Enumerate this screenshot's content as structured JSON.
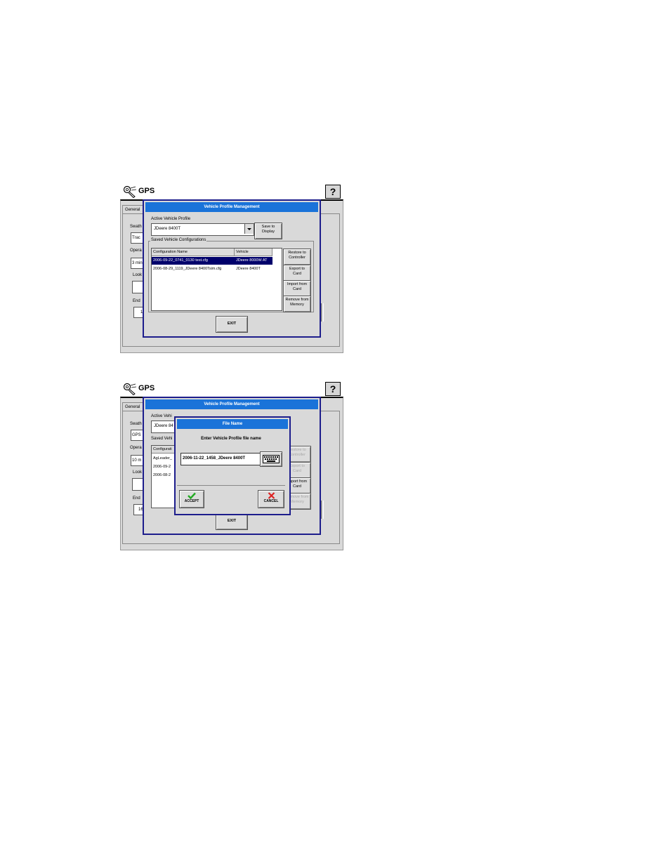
{
  "screen1": {
    "app_title": "GPS",
    "help_label": "?",
    "tab_general": "General",
    "side": {
      "swath": "Swath",
      "trac": "Trac",
      "opera": "Opera",
      "three_min": "3 min",
      "look": "Look",
      "end": "End",
      "one": "1"
    },
    "dialog": {
      "title": "Vehicle Profile Management",
      "active_label": "Active Vehicle Profile",
      "active_value": "JDeere 8400T",
      "save_button": "Save to\nDisplay",
      "saved_group_label": "Saved Vehicle Configurations",
      "columns": [
        "Configuration Name",
        "Vehicle"
      ],
      "rows": [
        {
          "name": "2006-09-22_0741_0130 test.cfg",
          "vehicle": "JDeere 8000W AT"
        },
        {
          "name": "2006-08-29_1119_JDeere 8400Tsim.cfg",
          "vehicle": "JDeere 8400T"
        }
      ],
      "buttons": {
        "restore": "Restore to\nController",
        "export": "Export to\nCard",
        "import": "Import from\nCard",
        "remove": "Remove from\nMemory"
      },
      "exit": "EXIT"
    }
  },
  "screen2": {
    "app_title": "GPS",
    "help_label": "?",
    "tab_general": "General",
    "side": {
      "swath": "Swath",
      "gps": "GPS",
      "opera": "Opera",
      "ten_m": "10 m",
      "look": "Look",
      "end": "End",
      "sixteen": "16"
    },
    "dialog": {
      "title": "Vehicle Profile Management",
      "active_label": "Active Vehi",
      "active_value": "JDeere 84",
      "saved_label": "Saved Vehi",
      "config_label": "Configurati",
      "rows": [
        "AgLeader_",
        "2006-09-2",
        "2006-08-2"
      ],
      "buttons": {
        "restore": "Restore to\nController",
        "export": "Export to\nCard",
        "import": "Import from\nCard",
        "remove": "Remove from\nMemory"
      },
      "exit": "EXIT"
    },
    "file_dialog": {
      "title": "File Name",
      "prompt": "Enter Vehicle Profile file name",
      "value": "2006-11-22_1458_JDeere 8400T",
      "accept": "ACCEPT",
      "cancel": "CANCEL"
    }
  },
  "colors": {
    "title_bar": "#1a73d9",
    "selection": "#00006b",
    "dialog_border": "#1d1d8c",
    "accept": "#22aa22",
    "cancel": "#dd2222"
  },
  "icons": [
    "wrench-icon",
    "keyboard-icon",
    "checkmark-icon",
    "x-icon",
    "dropdown-arrow-icon"
  ]
}
